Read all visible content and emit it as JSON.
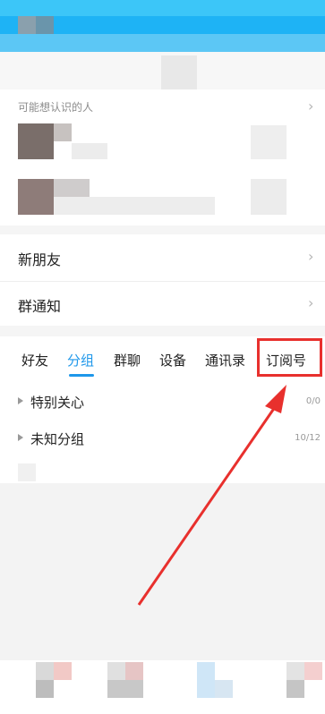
{
  "suggestions": {
    "label": "可能想认识的人"
  },
  "menu": {
    "new_friends": "新朋友",
    "group_notice": "群通知"
  },
  "tabs": [
    {
      "label": "好友"
    },
    {
      "label": "分组"
    },
    {
      "label": "群聊"
    },
    {
      "label": "设备"
    },
    {
      "label": "通讯录"
    },
    {
      "label": "订阅号"
    }
  ],
  "active_tab_index": 1,
  "groups": [
    {
      "name": "特别关心",
      "count": "0/0"
    },
    {
      "name": "未知分组",
      "count": "10/12"
    }
  ],
  "colors": {
    "header": "#1eb3f5",
    "accent": "#1e97ea",
    "highlight": "#e8302d"
  },
  "icons": {
    "chevron": "chevron-right-icon",
    "expand": "triangle-right-icon"
  }
}
